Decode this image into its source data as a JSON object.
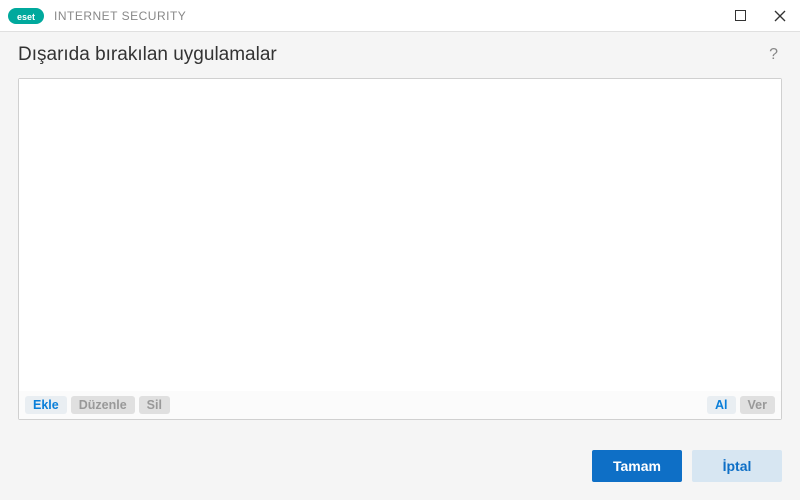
{
  "titlebar": {
    "brand": "eset",
    "product": "INTERNET SECURITY"
  },
  "page": {
    "title": "Dışarıda bırakılan uygulamalar",
    "help": "?"
  },
  "toolbar": {
    "add": "Ekle",
    "edit": "Düzenle",
    "delete": "Sil",
    "import": "Al",
    "export": "Ver"
  },
  "footer": {
    "ok": "Tamam",
    "cancel": "İptal"
  }
}
